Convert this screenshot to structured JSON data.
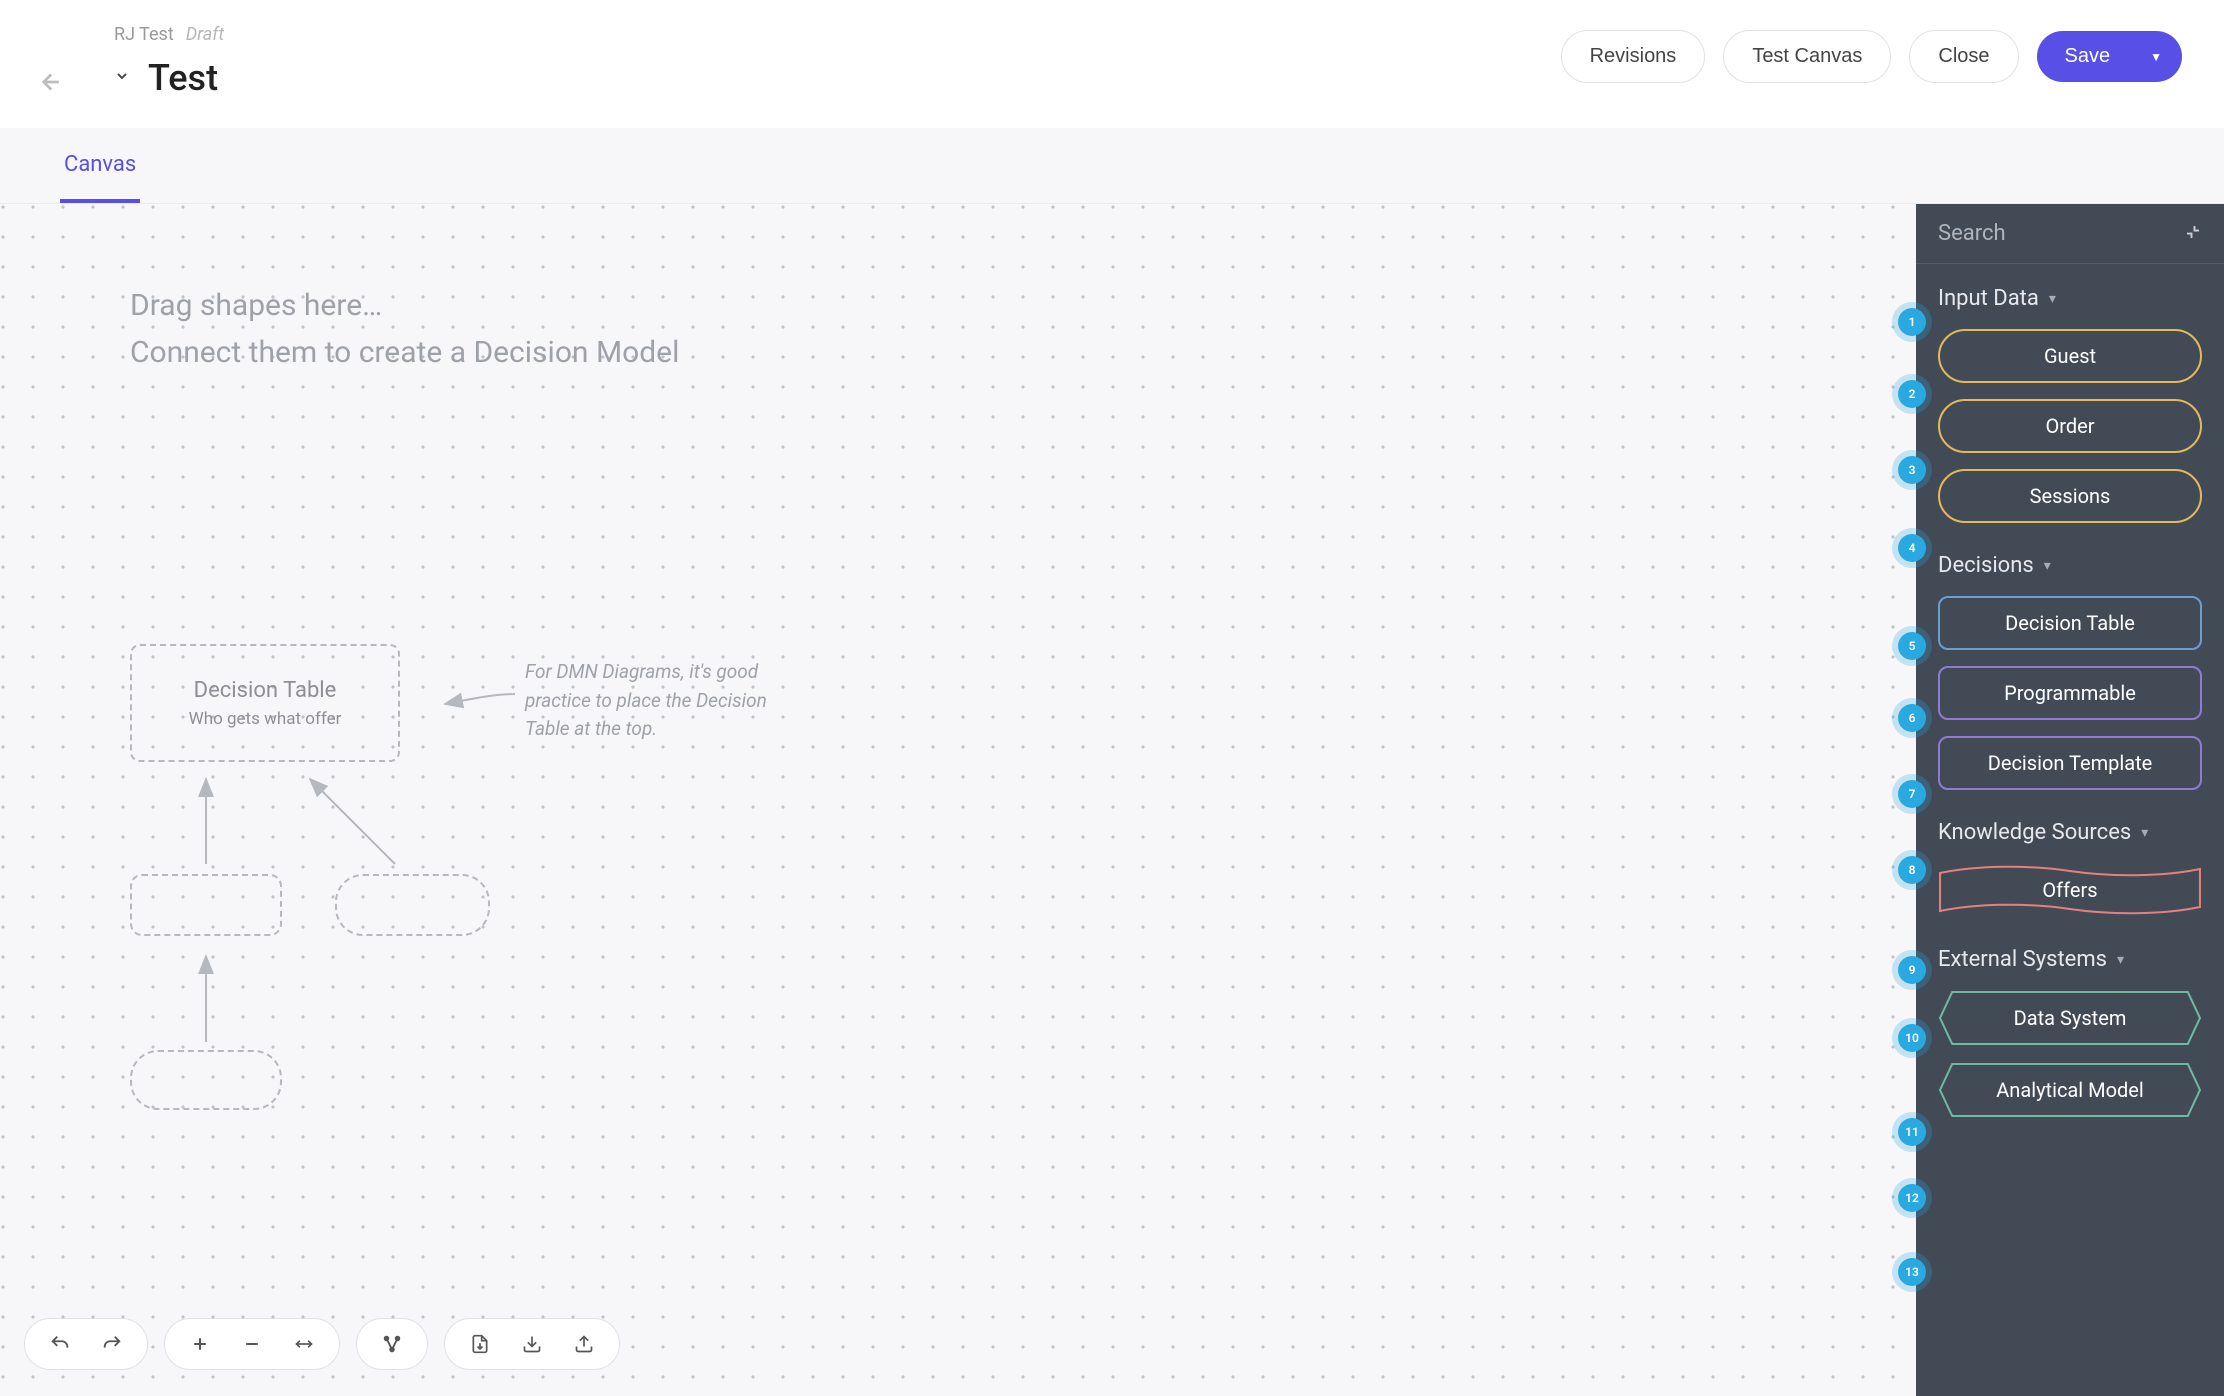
{
  "header": {
    "breadcrumb": "RJ Test",
    "status": "Draft",
    "title": "Test",
    "actions": {
      "revisions": "Revisions",
      "test_canvas": "Test Canvas",
      "close": "Close",
      "save": "Save"
    }
  },
  "tabs": {
    "canvas": "Canvas"
  },
  "canvas": {
    "guide_line1": "Drag shapes here…",
    "guide_line2": "Connect them to create a Decision Model",
    "decision_table_title": "Decision Table",
    "decision_table_sub": "Who gets what offer",
    "hint": "For DMN Diagrams, it's good practice to place the Decision Table at the top."
  },
  "sidebar": {
    "search_placeholder": "Search",
    "sections": {
      "input_data": {
        "label": "Input Data",
        "items": [
          "Guest",
          "Order",
          "Sessions"
        ]
      },
      "decisions": {
        "label": "Decisions",
        "items": [
          "Decision Table",
          "Programmable",
          "Decision Template"
        ]
      },
      "knowledge": {
        "label": "Knowledge Sources",
        "items": [
          "Offers"
        ]
      },
      "external": {
        "label": "External Systems",
        "items": [
          "Data System",
          "Analytical Model"
        ]
      }
    }
  },
  "tour_numbers": [
    "1",
    "2",
    "3",
    "4",
    "5",
    "6",
    "7",
    "8",
    "9",
    "10",
    "11",
    "12",
    "13"
  ]
}
